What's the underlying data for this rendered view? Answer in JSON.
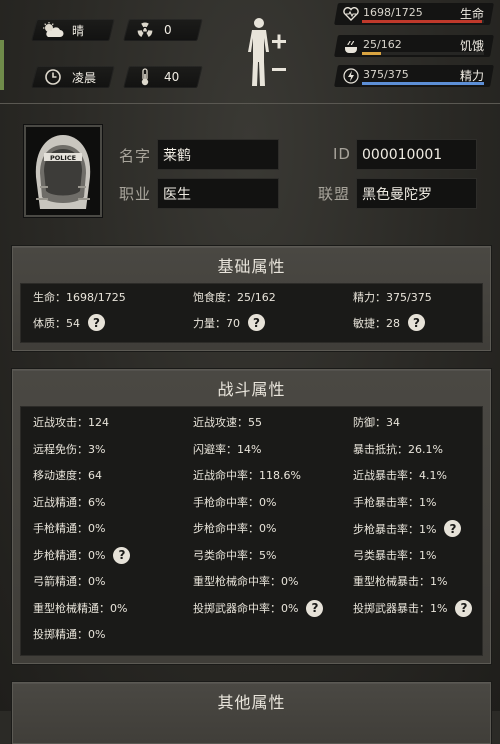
{
  "weather": {
    "label": "晴",
    "icon": "partly-cloudy-icon"
  },
  "radiation": {
    "value": "0",
    "icon": "radiation-icon"
  },
  "time_of_day": {
    "label": "凌晨",
    "icon": "clock-icon"
  },
  "temperature": {
    "value": "40",
    "icon": "thermometer-icon"
  },
  "vitals": [
    {
      "icon": "heart-icon",
      "value": "1698/1725",
      "label": "生命",
      "fill": 0.984,
      "color": "#c0392b"
    },
    {
      "icon": "food-icon",
      "value": "25/162",
      "label": "饥饿",
      "fill": 0.154,
      "color": "#d9a441"
    },
    {
      "icon": "energy-icon",
      "value": "375/375",
      "label": "精力",
      "fill": 1.0,
      "color": "#5d8fd6"
    }
  ],
  "profile": {
    "name_label": "名字",
    "name": "莱鹤",
    "job_label": "职业",
    "job": "医生",
    "id_label": "ID",
    "id": "000010001",
    "alliance_label": "联盟",
    "alliance": "黑色曼陀罗",
    "avatar_text": "POLICE"
  },
  "basic": {
    "title": "基础属性",
    "items": [
      "生命：1698/1725",
      "饱食度：25/162",
      "精力：375/375",
      "体质：54",
      "力量：70",
      "敏捷：28"
    ],
    "help": "?"
  },
  "combat": {
    "title": "战斗属性",
    "items": [
      "近战攻击：124",
      "近战攻速：55",
      "防御：34",
      "远程免伤：3%",
      "闪避率：14%",
      "暴击抵抗：26.1%",
      "移动速度：64",
      "近战命中率：118.6%",
      "近战暴击率：4.1%",
      "近战精通：6%",
      "手枪命中率：0%",
      "手枪暴击率：1%",
      "手枪精通：0%",
      "步枪命中率：0%",
      "步枪暴击率：1%",
      "步枪精通：0%",
      "弓类命中率：5%",
      "弓类暴击率：1%",
      "弓箭精通：0%",
      "重型枪械命中率：0%",
      "重型枪械暴击：1%",
      "重型枪械精通：0%",
      "投掷武器命中率：0%",
      "投掷武器暴击：1%",
      "投掷精通：0%"
    ],
    "help": "?"
  },
  "other": {
    "title": "其他属性"
  }
}
